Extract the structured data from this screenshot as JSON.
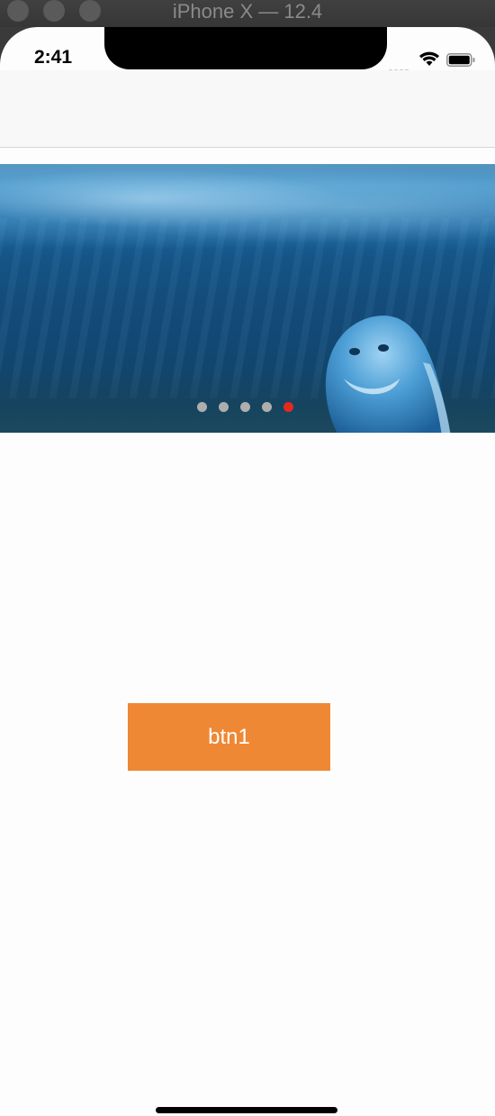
{
  "window": {
    "title": "iPhone X — 12.4"
  },
  "status_bar": {
    "time": "2:41",
    "signal_icon": "cellular-signal-icon",
    "wifi_icon": "wifi-icon",
    "battery_icon": "battery-icon"
  },
  "banner": {
    "image": "underwater-dolphin-image",
    "page_count": 5,
    "current_page": 5,
    "dot_color": "#aeaeae",
    "active_dot_color": "#e4291f"
  },
  "main": {
    "button_label": "btn1",
    "button_color": "#ef8834"
  }
}
